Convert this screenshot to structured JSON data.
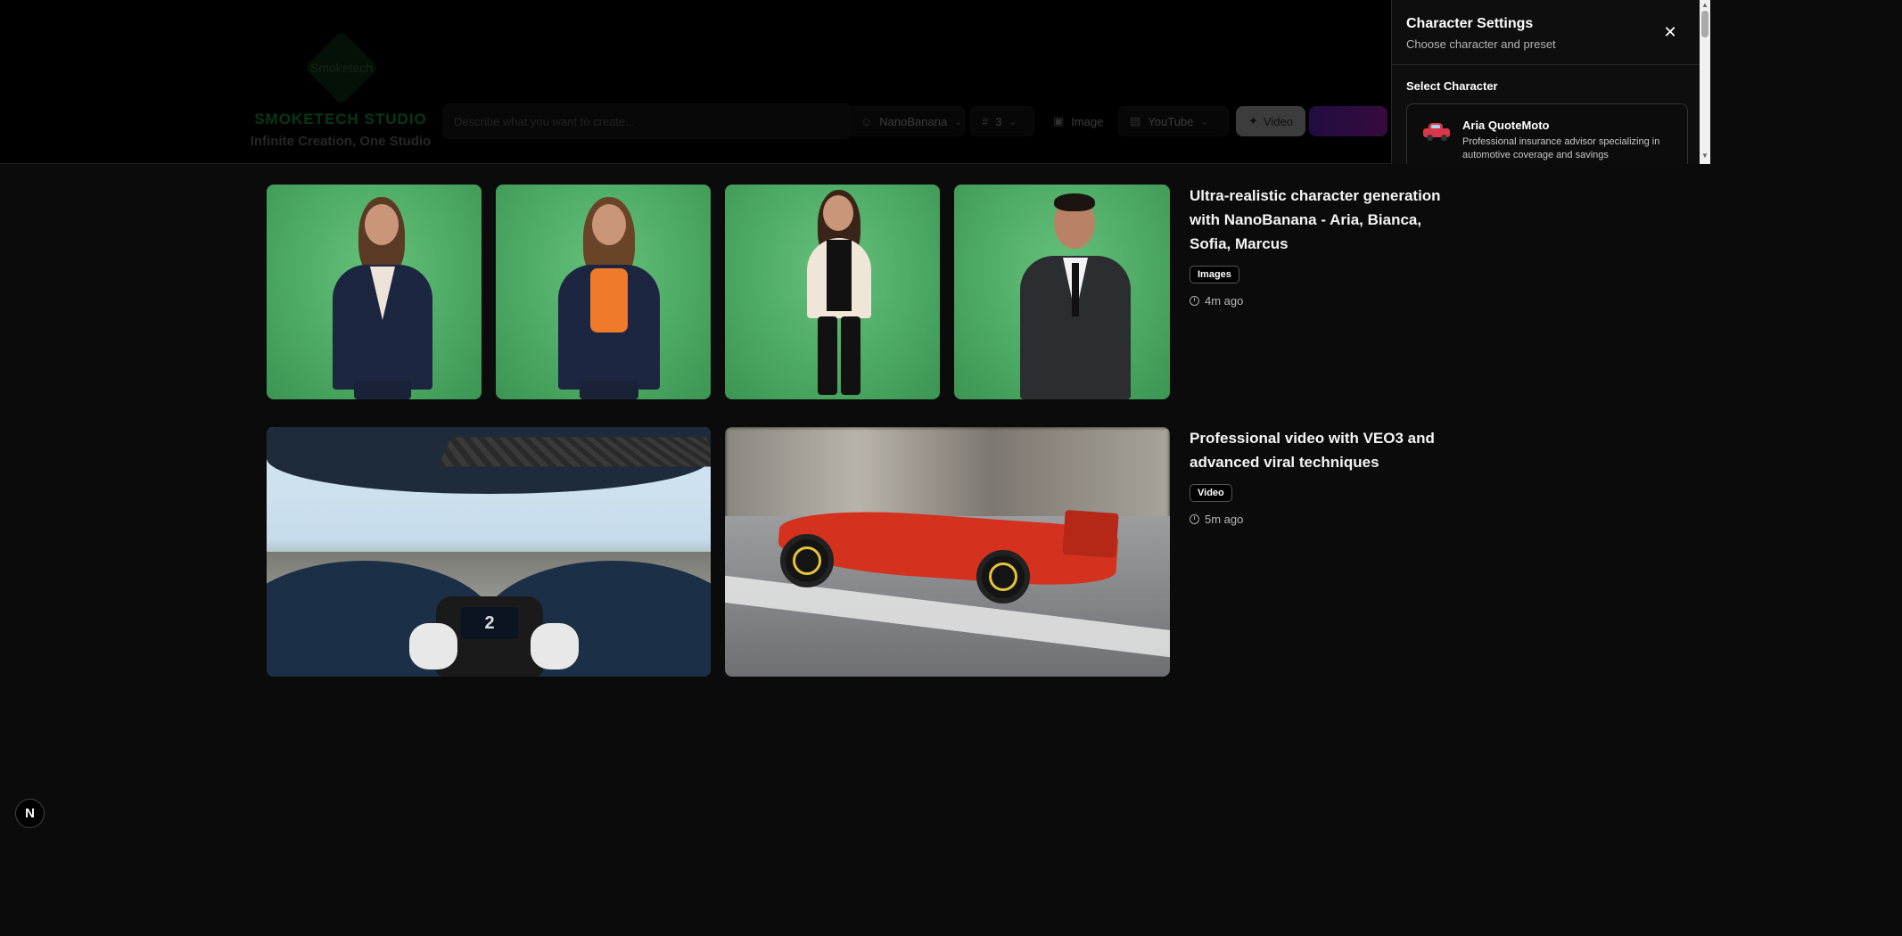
{
  "header": {
    "logo_mark_text": "Smoketech",
    "brand_name": "SMOKETECH STUDIO",
    "brand_tagline": "Infinite Creation, One Studio",
    "prompt_placeholder": "Describe what you want to create...",
    "model": "NanoBanana",
    "count": "3",
    "type": "Image",
    "platform": "YouTube",
    "create_label": "Video"
  },
  "feed": [
    {
      "title": "Ultra-realistic character generation with NanoBanana - Aria, Bianca, Sofia, Marcus",
      "badge": "Images",
      "time": "4m ago"
    },
    {
      "title": "Professional video with VEO3 and advanced viral techniques",
      "badge": "Video",
      "time": "5m ago"
    }
  ],
  "panel": {
    "title": "Character Settings",
    "subtitle": "Choose character and preset",
    "section_label": "Select Character",
    "characters": [
      {
        "name": "Aria QuoteMoto",
        "description": "Professional insurance advisor specializing in automotive coverage and savings"
      }
    ]
  },
  "dev_badge": "N",
  "colors": {
    "brand_green": "#18c44a",
    "generate_gradient_start": "#7a2be8",
    "generate_gradient_end": "#c12ad6",
    "greenscreen": "#4daa64"
  }
}
